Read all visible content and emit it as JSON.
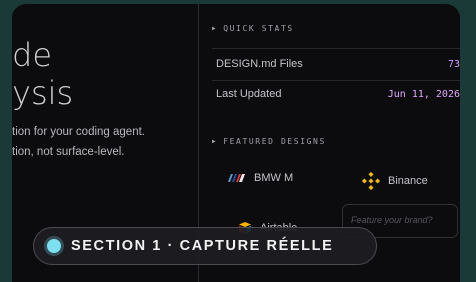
{
  "hero": {
    "title_line1": "de",
    "title_line2": "ysis",
    "desc_line1": "tion for your coding agent.",
    "desc_line2": "tion, not surface-level."
  },
  "quick_stats": {
    "heading": "QUICK STATS",
    "items": [
      {
        "label": "DESIGN.md Files",
        "value": "73",
        "color": "#c9a0ff"
      },
      {
        "label": "Last Updated",
        "value": "Jun 11, 2026",
        "color": "#e0a8ff"
      }
    ]
  },
  "featured": {
    "heading": "FEATURED DESIGNS",
    "items": [
      {
        "label": "BMW M",
        "icon": "bmw-m-logo-icon"
      },
      {
        "label": "Binance",
        "icon": "binance-logo-icon"
      },
      {
        "label": "Airtable",
        "icon": "airtable-logo-icon"
      }
    ],
    "input_placeholder": "Feature your brand?"
  },
  "badge": {
    "text": "SECTION 1 · CAPTURE RÉELLE",
    "dot_color": "#7de0f0"
  }
}
